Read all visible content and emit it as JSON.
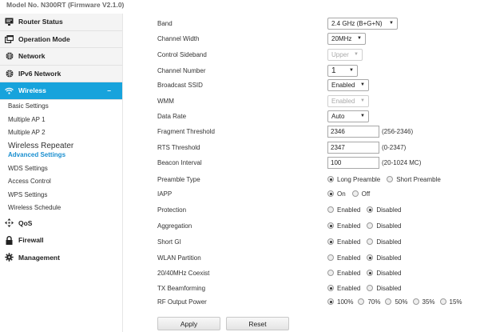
{
  "model": "Model No. N300RT (Firmware V2.1.0)",
  "sidebar": {
    "items": [
      {
        "label": "Router Status",
        "icon": "monitor-icon"
      },
      {
        "label": "Operation Mode",
        "icon": "window-icon"
      },
      {
        "label": "Network",
        "icon": "globe-icon"
      },
      {
        "label": "IPv6 Network",
        "icon": "globe-icon"
      },
      {
        "label": "Wireless",
        "icon": "wifi-icon",
        "toggle": "–"
      },
      {
        "label": "QoS",
        "icon": "qos-icon"
      },
      {
        "label": "Firewall",
        "icon": "lock-icon"
      },
      {
        "label": "Management",
        "icon": "gear-icon"
      }
    ],
    "wireless_sub": [
      "Basic Settings",
      "Multiple AP 1",
      "Multiple AP 2",
      "Wireless Repeater",
      "Advanced Settings",
      "WDS Settings",
      "Access Control",
      "WPS Settings",
      "Wireless Schedule"
    ]
  },
  "form": {
    "band": {
      "label": "Band",
      "value": "2.4 GHz (B+G+N)"
    },
    "channel_width": {
      "label": "Channel Width",
      "value": "20MHz"
    },
    "control_sideband": {
      "label": "Control Sideband",
      "value": "Upper"
    },
    "channel_number": {
      "label": "Channel Number",
      "value": "1"
    },
    "broadcast_ssid": {
      "label": "Broadcast SSID",
      "value": "Enabled"
    },
    "wmm": {
      "label": "WMM",
      "value": "Enabled"
    },
    "data_rate": {
      "label": "Data Rate",
      "value": "Auto"
    },
    "frag": {
      "label": "Fragment Threshold",
      "value": "2346",
      "hint": "(256-2346)"
    },
    "rts": {
      "label": "RTS Threshold",
      "value": "2347",
      "hint": "(0-2347)"
    },
    "beacon": {
      "label": "Beacon Interval",
      "value": "100",
      "hint": "(20-1024 MC)"
    },
    "preamble": {
      "label": "Preamble Type",
      "opt1": "Long Preamble",
      "opt2": "Short Preamble"
    },
    "iapp": {
      "label": "IAPP",
      "opt1": "On",
      "opt2": "Off"
    },
    "protection": {
      "label": "Protection",
      "opt1": "Enabled",
      "opt2": "Disabled"
    },
    "aggregation": {
      "label": "Aggregation",
      "opt1": "Enabled",
      "opt2": "Disabled"
    },
    "short_gi": {
      "label": "Short GI",
      "opt1": "Enabled",
      "opt2": "Disabled"
    },
    "wlan_partition": {
      "label": "WLAN Partition",
      "opt1": "Enabled",
      "opt2": "Disabled"
    },
    "coexist": {
      "label": "20/40MHz Coexist",
      "opt1": "Enabled",
      "opt2": "Disabled"
    },
    "tx_beam": {
      "label": "TX Beamforming",
      "opt1": "Enabled",
      "opt2": "Disabled"
    },
    "rf_power": {
      "label": "RF Output Power",
      "options": [
        "100%",
        "70%",
        "50%",
        "35%",
        "15%"
      ]
    }
  },
  "buttons": {
    "apply": "Apply",
    "reset": "Reset"
  }
}
